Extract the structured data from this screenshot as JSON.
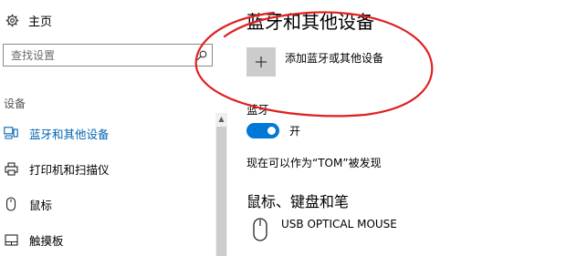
{
  "sidebar": {
    "home_icon": "gear-icon",
    "home_label": "主页",
    "search": {
      "placeholder": "查找设置",
      "icon": "search-icon"
    },
    "section_title": "设备",
    "items": [
      {
        "label": "蓝牙和其他设备",
        "icon": "bluetooth-devices-icon",
        "active": true
      },
      {
        "label": "打印机和扫描仪",
        "icon": "printer-icon",
        "active": false
      },
      {
        "label": "鼠标",
        "icon": "mouse-icon",
        "active": false
      },
      {
        "label": "触摸板",
        "icon": "touchpad-icon",
        "active": false
      }
    ]
  },
  "main": {
    "title": "蓝牙和其他设备",
    "add_device_label": "添加蓝牙或其他设备",
    "bluetooth": {
      "heading": "蓝牙",
      "toggle_state": "开",
      "toggle_on": true,
      "discoverable_text": "现在可以作为“TOM”被发现"
    },
    "mouse_section": {
      "title": "鼠标、键盘和笔",
      "devices": [
        {
          "name": "USB OPTICAL MOUSE",
          "icon": "mouse-icon"
        }
      ]
    }
  },
  "colors": {
    "accent": "#0078d7",
    "active_text": "#0063b1",
    "annotation": "#e02020",
    "add_tile": "#cccccc"
  }
}
